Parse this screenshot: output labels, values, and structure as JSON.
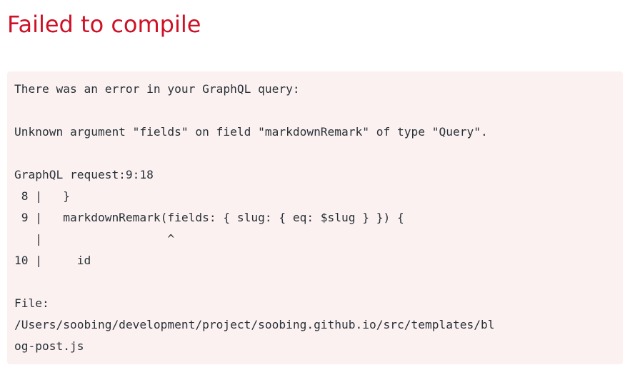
{
  "header": {
    "title": "Failed to compile",
    "title_color": "#ce1126"
  },
  "error": {
    "background_color": "#fcf1f1",
    "text_color": "#293238",
    "intro": "There was an error in your GraphQL query:",
    "message": "Unknown argument \"fields\" on field \"markdownRemark\" of type \"Query\".",
    "request_location": "GraphQL request:9:18",
    "code_frame": [
      " 8 |   }",
      " 9 |   markdownRemark(fields: { slug: { eq: $slug } }) {",
      "   |                  ^",
      "10 |     id"
    ],
    "file_label": "File:",
    "file_path_lines": [
      "/Users/soobing/development/project/soobing.github.io/src/templates/bl",
      "og-post.js"
    ]
  }
}
